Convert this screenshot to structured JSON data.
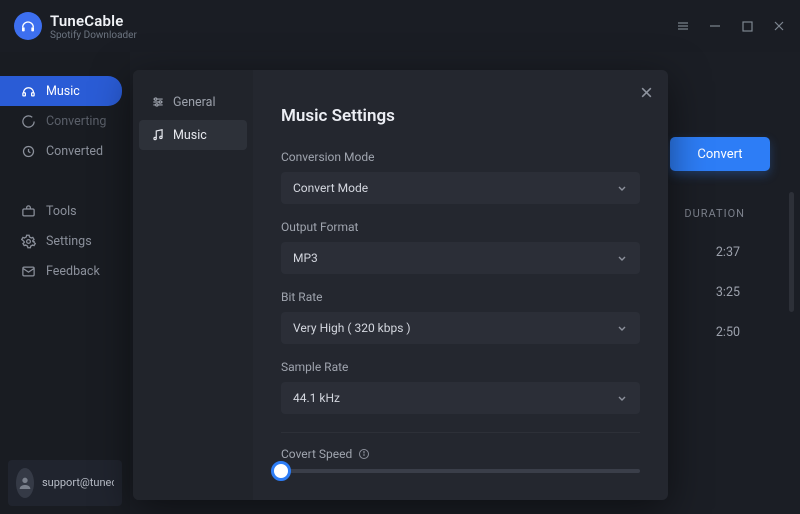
{
  "brand": {
    "title": "TuneCable",
    "subtitle": "Spotify Downloader"
  },
  "sidebar": {
    "items": [
      {
        "label": "Music"
      },
      {
        "label": "Converting"
      },
      {
        "label": "Converted"
      }
    ],
    "items2": [
      {
        "label": "Tools"
      },
      {
        "label": "Settings"
      },
      {
        "label": "Feedback"
      }
    ]
  },
  "support": {
    "email": "support@tunecable.com"
  },
  "actions": {
    "convert": "Convert"
  },
  "background": {
    "colDuration": "DURATION",
    "rows": [
      "2:37",
      "3:25",
      "2:50"
    ]
  },
  "modal": {
    "tabs": [
      {
        "label": "General"
      },
      {
        "label": "Music"
      }
    ],
    "title": "Music Settings",
    "fields": {
      "conversionMode": {
        "label": "Conversion Mode",
        "value": "Convert Mode"
      },
      "outputFormat": {
        "label": "Output Format",
        "value": "MP3"
      },
      "bitRate": {
        "label": "Bit Rate",
        "value": "Very High ( 320 kbps )"
      },
      "sampleRate": {
        "label": "Sample Rate",
        "value": "44.1 kHz"
      },
      "covertSpeed": {
        "label": "Covert Speed"
      }
    }
  }
}
